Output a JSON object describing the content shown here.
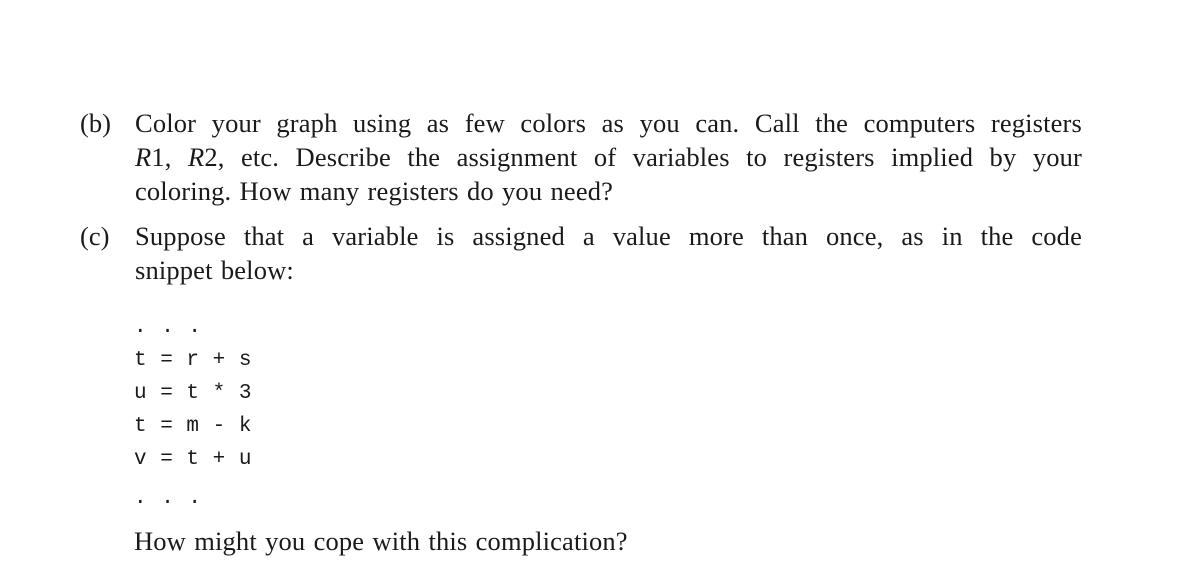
{
  "items": [
    {
      "label": "(b)",
      "lines": [
        "Color your graph using as few colors as you can. Call the computers registers",
        "R1, R2, etc. Describe the assignment of variables to registers implied by your",
        "coloring. How many registers do you need?"
      ]
    },
    {
      "label": "(c)",
      "lines": [
        "Suppose that a variable is assigned a value more than once, as in the code",
        "snippet below:"
      ]
    }
  ],
  "code": {
    "ellipsis_top": ". . .",
    "lines": [
      "t = r + s",
      "u = t * 3",
      "t = m - k",
      "v = t + u"
    ],
    "ellipsis_bottom": ". . ."
  },
  "question": "How might you cope with this complication?"
}
